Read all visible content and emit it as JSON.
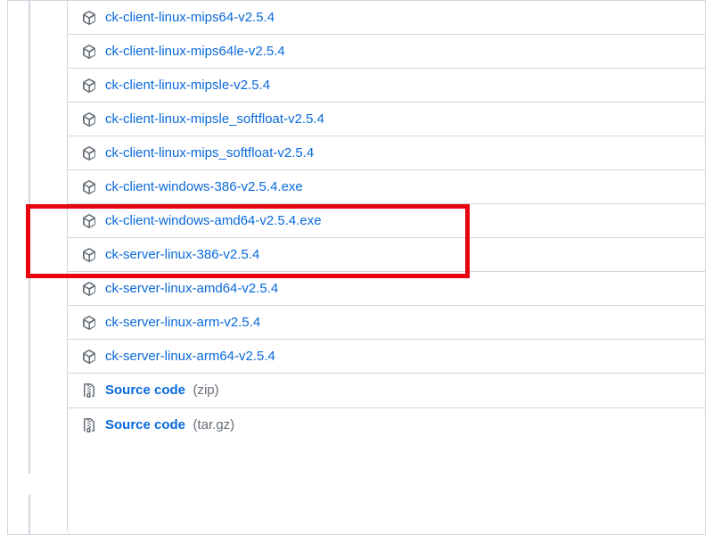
{
  "assets": [
    {
      "name": "ck-client-linux-mips64-v2.5.4",
      "type": "package"
    },
    {
      "name": "ck-client-linux-mips64le-v2.5.4",
      "type": "package"
    },
    {
      "name": "ck-client-linux-mipsle-v2.5.4",
      "type": "package"
    },
    {
      "name": "ck-client-linux-mipsle_softfloat-v2.5.4",
      "type": "package"
    },
    {
      "name": "ck-client-linux-mips_softfloat-v2.5.4",
      "type": "package"
    },
    {
      "name": "ck-client-windows-386-v2.5.4.exe",
      "type": "package"
    },
    {
      "name": "ck-client-windows-amd64-v2.5.4.exe",
      "type": "package"
    },
    {
      "name": "ck-server-linux-386-v2.5.4",
      "type": "package"
    },
    {
      "name": "ck-server-linux-amd64-v2.5.4",
      "type": "package"
    },
    {
      "name": "ck-server-linux-arm-v2.5.4",
      "type": "package"
    },
    {
      "name": "ck-server-linux-arm64-v2.5.4",
      "type": "package"
    }
  ],
  "source": [
    {
      "label": "Source code",
      "ext": "(zip)"
    },
    {
      "label": "Source code",
      "ext": "(tar.gz)"
    }
  ]
}
